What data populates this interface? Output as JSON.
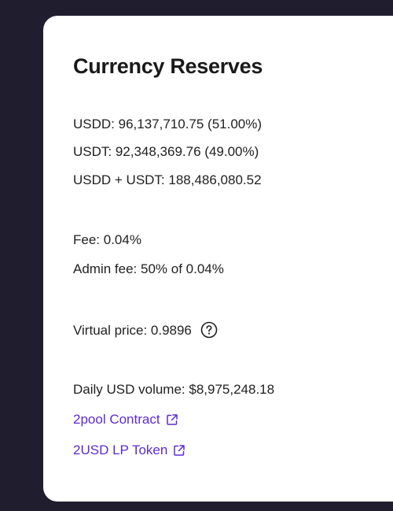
{
  "card": {
    "title": "Currency Reserves",
    "reserves": {
      "usdd": "USDD: 96,137,710.75 (51.00%)",
      "usdt": "USDT: 92,348,369.76 (49.00%)",
      "total": "USDD + USDT: 188,486,080.52"
    },
    "fees": {
      "fee": "Fee: 0.04%",
      "admin_fee": "Admin fee: 50% of 0.04%"
    },
    "virtual_price": "Virtual price: 0.9896",
    "daily_volume": "Daily USD volume: $8,975,248.18",
    "links": {
      "contract": "2pool Contract",
      "lp_token": "2USD LP Token"
    },
    "icons": {
      "help": "help-circle-icon",
      "external": "external-link-icon"
    },
    "colors": {
      "background": "#1f1d2e",
      "link": "#5b2bd6"
    }
  }
}
